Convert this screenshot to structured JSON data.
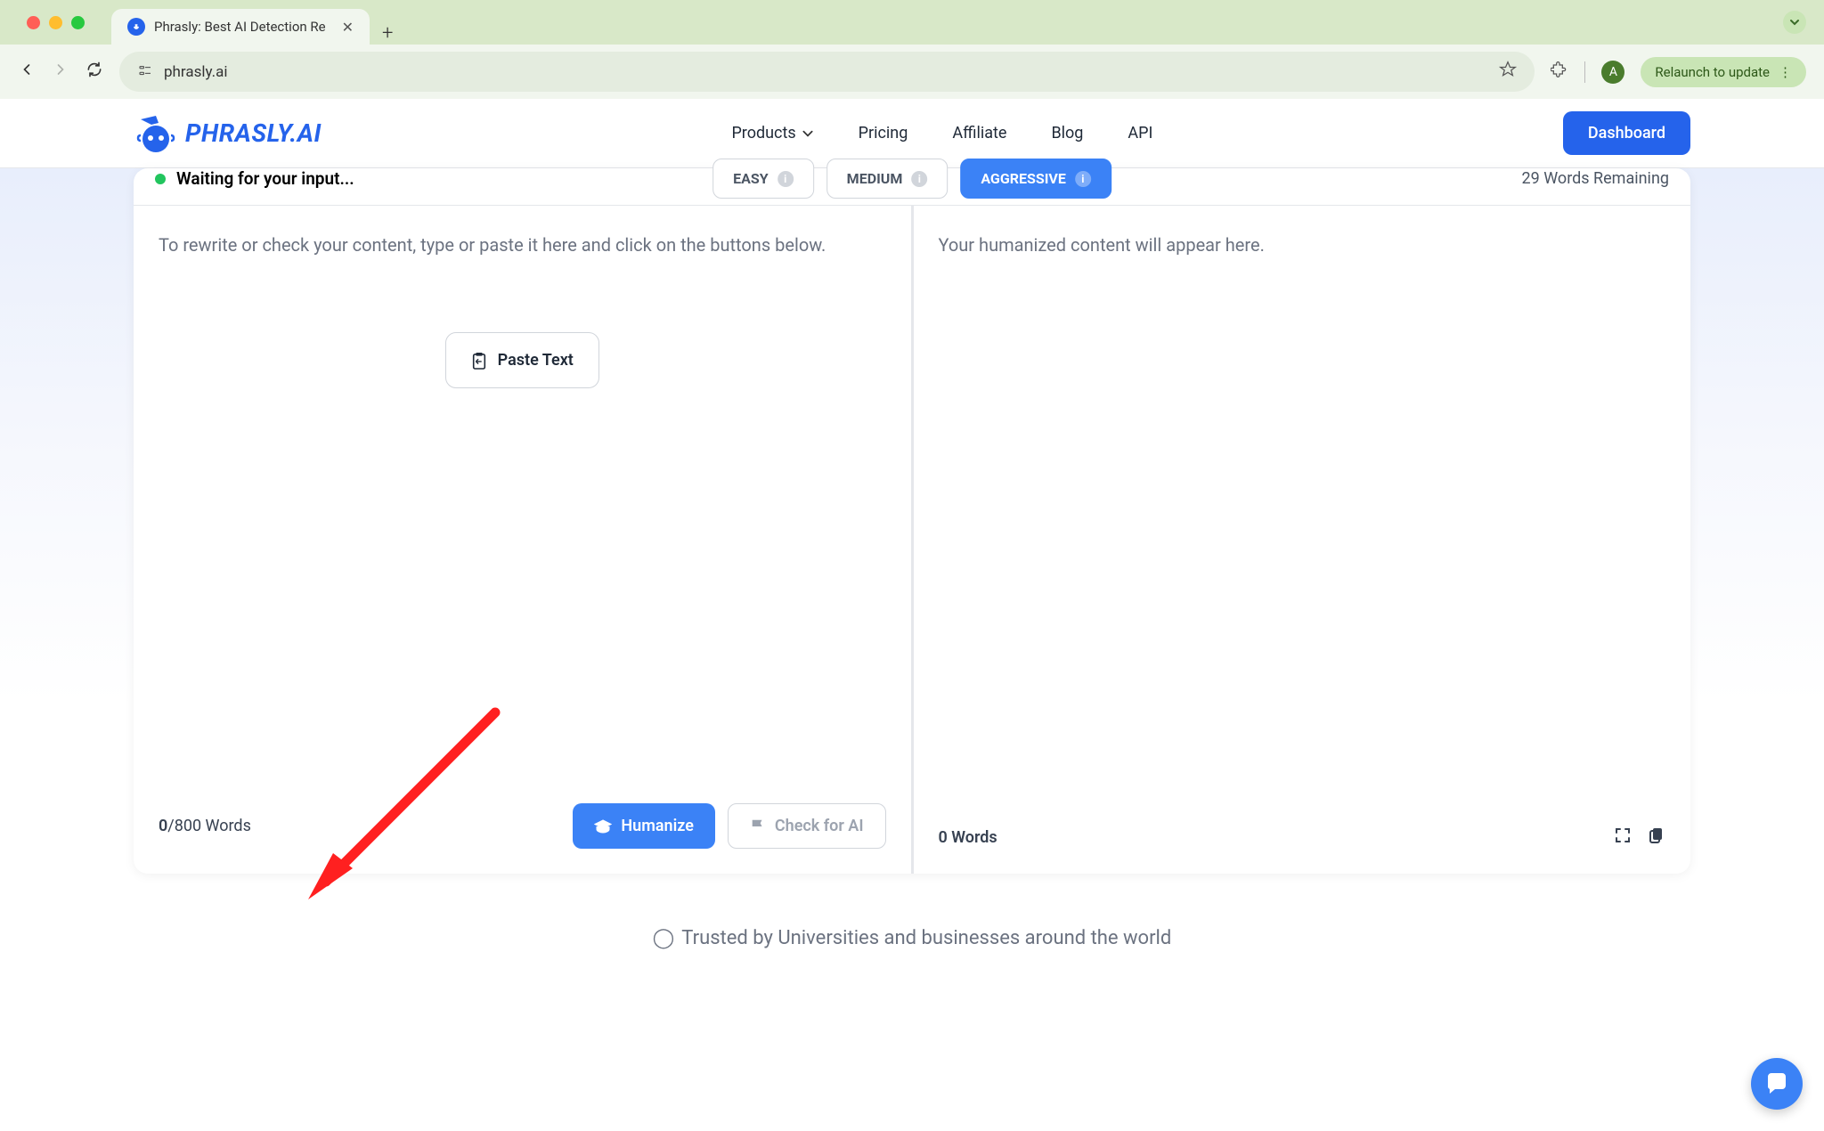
{
  "browser": {
    "tab_title": "Phrasly: Best AI Detection Re",
    "url": "phrasly.ai",
    "relaunch": "Relaunch to update",
    "profile_letter": "A"
  },
  "header": {
    "logo_text": "PHRASLY.AI",
    "nav": {
      "products": "Products",
      "pricing": "Pricing",
      "affiliate": "Affiliate",
      "blog": "Blog",
      "api": "API"
    },
    "dashboard": "Dashboard"
  },
  "editor": {
    "status": "Waiting for your input...",
    "difficulty": {
      "easy": "EASY",
      "medium": "MEDIUM",
      "aggressive": "AGGRESSIVE"
    },
    "remaining": "29 Words Remaining",
    "input_placeholder": "To rewrite or check your content, type or paste it here and click on the buttons below.",
    "output_placeholder": "Your humanized content will appear here.",
    "paste_text": "Paste Text",
    "word_count_left_count": "0",
    "word_count_left_limit": "/800 Words",
    "word_count_right": "0 Words",
    "humanize": "Humanize",
    "check_ai": "Check for AI"
  },
  "banner": {
    "trusted": "Trusted by Universities and businesses around the world"
  }
}
